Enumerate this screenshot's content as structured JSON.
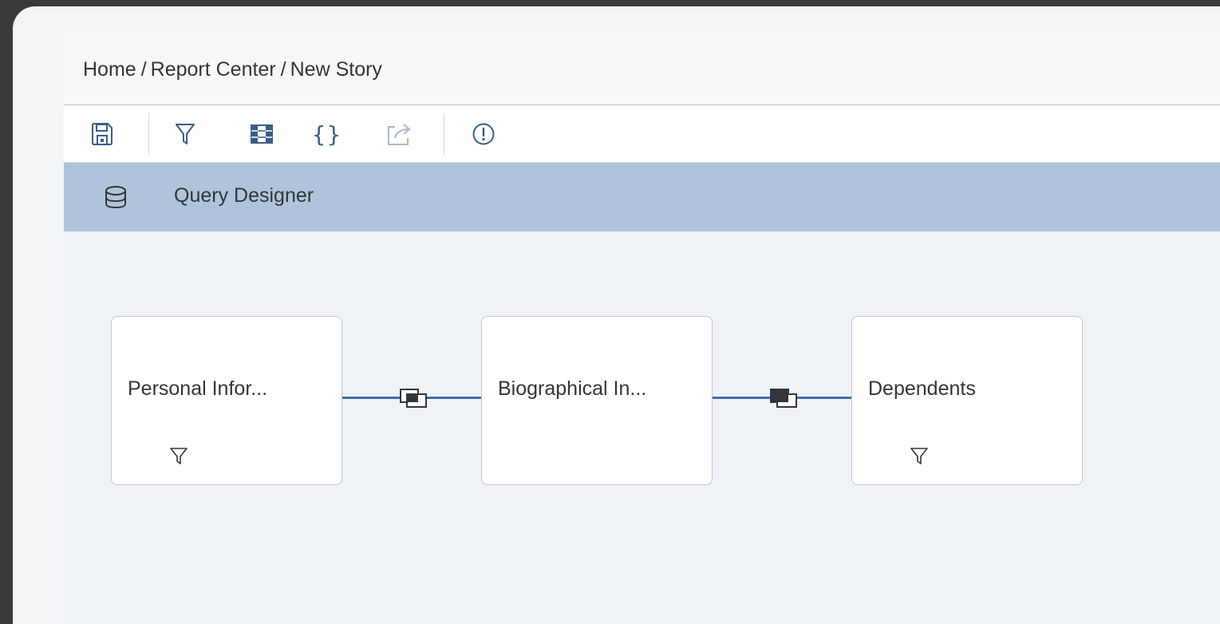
{
  "breadcrumb": {
    "items": [
      "Home",
      "Report Center",
      "New Story"
    ],
    "separator": "/"
  },
  "toolbar": {
    "buttons": [
      {
        "name": "save",
        "icon": "save-icon"
      },
      {
        "name": "filter",
        "icon": "filter-icon"
      },
      {
        "name": "columns",
        "icon": "columns-icon"
      },
      {
        "name": "formula",
        "icon": "braces-icon",
        "text": "{}"
      },
      {
        "name": "export",
        "icon": "share-icon",
        "disabled": true
      },
      {
        "name": "validate",
        "icon": "alert-circle-icon"
      }
    ]
  },
  "section": {
    "title": "Query Designer",
    "icon": "database-icon"
  },
  "nodes": [
    {
      "label": "Personal Infor...",
      "has_filter": true
    },
    {
      "label": "Biographical In...",
      "has_filter": false
    },
    {
      "label": "Dependents",
      "has_filter": true
    }
  ],
  "joins": [
    {
      "icon": "join-icon"
    },
    {
      "icon": "join-icon"
    }
  ],
  "colors": {
    "accent": "#3f6fab",
    "header_bg": "#afc4da",
    "canvas_bg": "#eff2f6",
    "icon": "#3a5e87"
  }
}
